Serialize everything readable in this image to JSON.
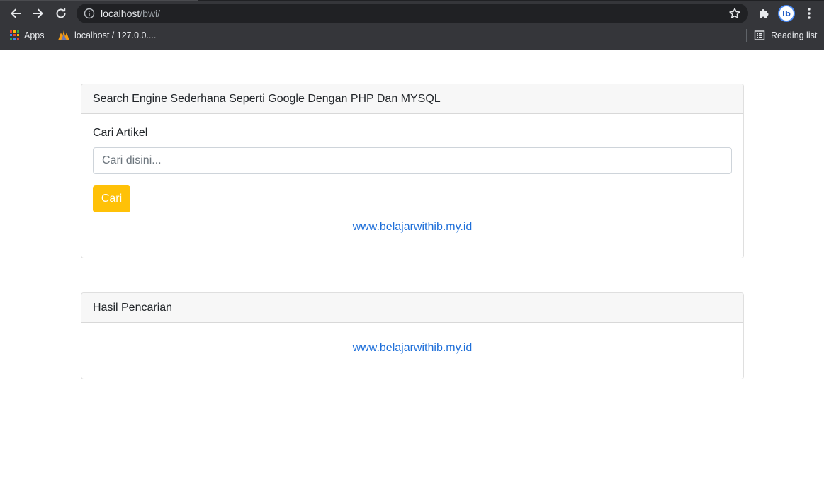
{
  "browser": {
    "url_host": "localhost",
    "url_path": "/bwi/",
    "bookmarks": [
      {
        "label": "Apps"
      },
      {
        "label": "localhost / 127.0.0...."
      }
    ],
    "reading_list_label": "Reading list",
    "profile_initials": "lb",
    "icons": [
      "back-arrow-icon",
      "forward-arrow-icon",
      "reload-icon",
      "info-icon",
      "star-icon",
      "extensions-puzzle-icon",
      "more-vert-icon",
      "apps-grid-icon",
      "phpmyadmin-icon",
      "reading-list-icon"
    ],
    "colors": {
      "chrome": "#35363a",
      "omnibox": "#202124"
    }
  },
  "search_card": {
    "header": "Search Engine Sederhana Seperti Google Dengan PHP Dan MYSQL",
    "label": "Cari Artikel",
    "input_placeholder": "Cari disini...",
    "input_value": "",
    "button_label": "Cari",
    "footer_link": "www.belajarwithib.my.id"
  },
  "results_card": {
    "header": "Hasil Pencarian",
    "footer_link": "www.belajarwithib.my.id"
  },
  "colors": {
    "button": "#ffc107",
    "link": "#1e6fd9",
    "card_header_bg": "#f7f7f7"
  }
}
